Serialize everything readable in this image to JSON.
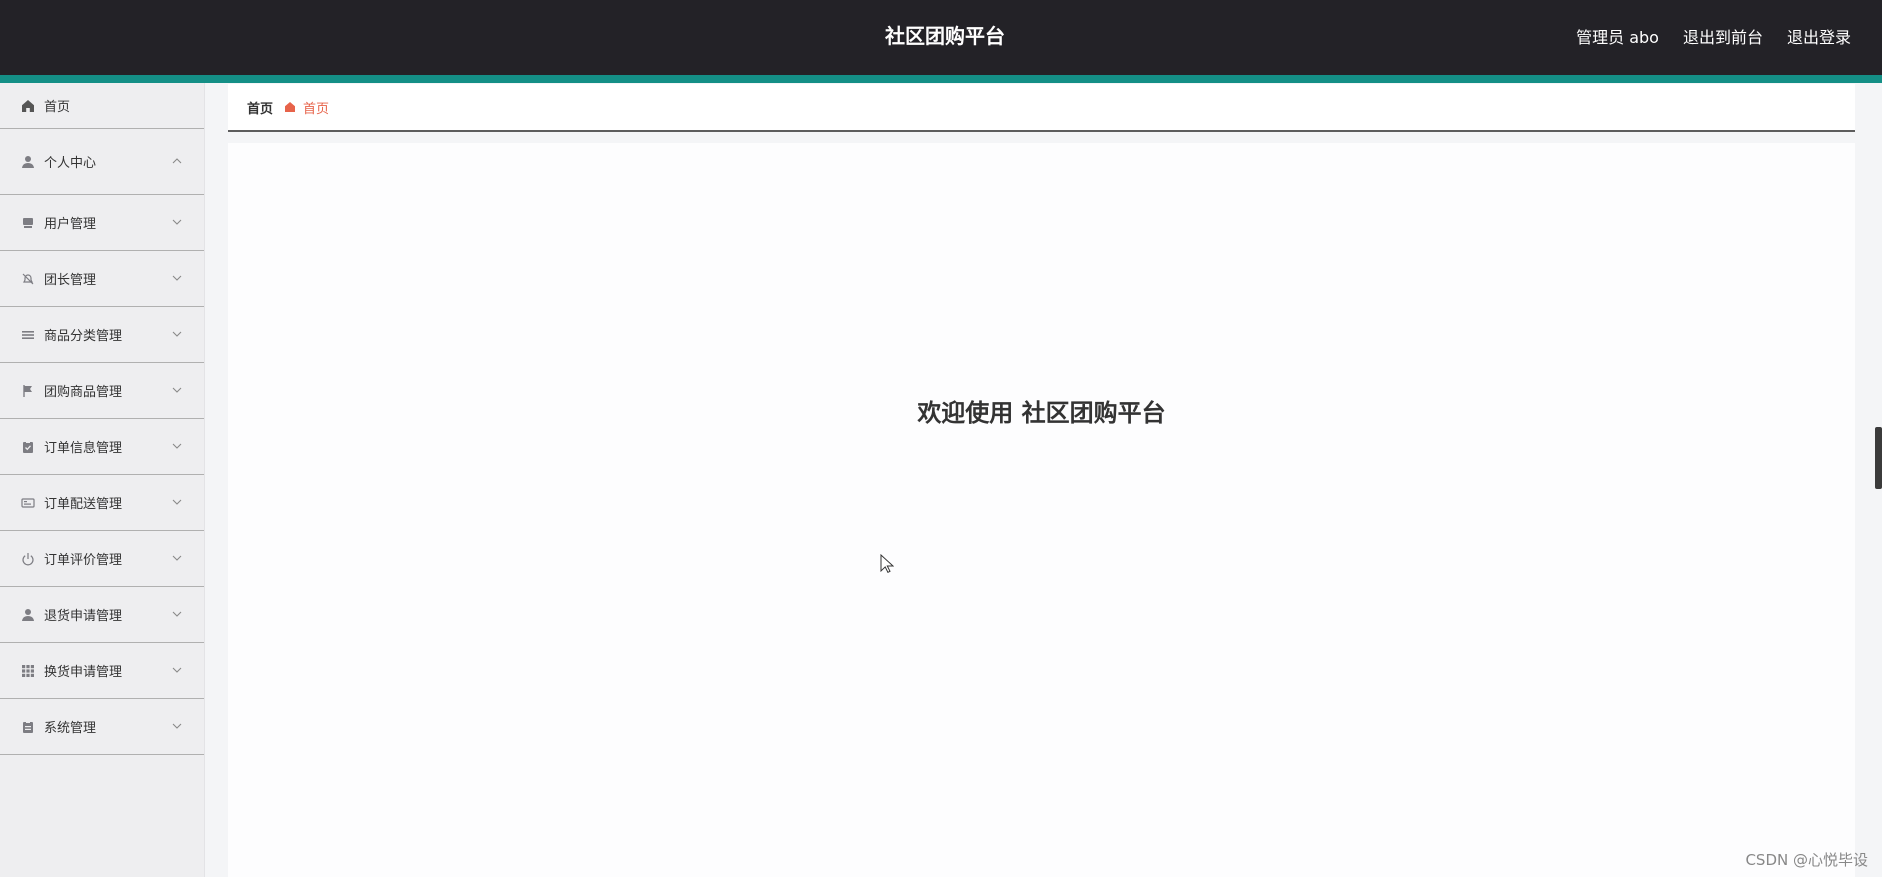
{
  "app": {
    "title": "社区团购平台",
    "admin_label": "管理员 abo",
    "back_to_front": "退出到前台",
    "logout": "退出登录"
  },
  "sidebar": {
    "items": [
      {
        "label": "首页",
        "icon": "home-icon",
        "chevron": "none"
      },
      {
        "label": "个人中心",
        "icon": "user-icon",
        "chevron": "up"
      },
      {
        "label": "用户管理",
        "icon": "users-management-icon",
        "chevron": "down"
      },
      {
        "label": "团长管理",
        "icon": "bell-off-icon",
        "chevron": "down"
      },
      {
        "label": "商品分类管理",
        "icon": "list-icon",
        "chevron": "down"
      },
      {
        "label": "团购商品管理",
        "icon": "flag-icon",
        "chevron": "down"
      },
      {
        "label": "订单信息管理",
        "icon": "clipboard-check-icon",
        "chevron": "down"
      },
      {
        "label": "订单配送管理",
        "icon": "id-card-icon",
        "chevron": "down"
      },
      {
        "label": "订单评价管理",
        "icon": "power-icon",
        "chevron": "down"
      },
      {
        "label": "退货申请管理",
        "icon": "person-icon",
        "chevron": "down"
      },
      {
        "label": "换货申请管理",
        "icon": "grid-icon",
        "chevron": "down"
      },
      {
        "label": "系统管理",
        "icon": "clipboard-icon",
        "chevron": "down"
      }
    ]
  },
  "breadcrumb": {
    "home": "首页",
    "current": "首页"
  },
  "main": {
    "welcome": "欢迎使用 社区团购平台"
  },
  "watermark": "CSDN @心悦毕设",
  "colors": {
    "topbar": "#232227",
    "accent": "#148f86",
    "sidebar": "#eeeef0",
    "breadcrumb_current": "#e7634a"
  }
}
